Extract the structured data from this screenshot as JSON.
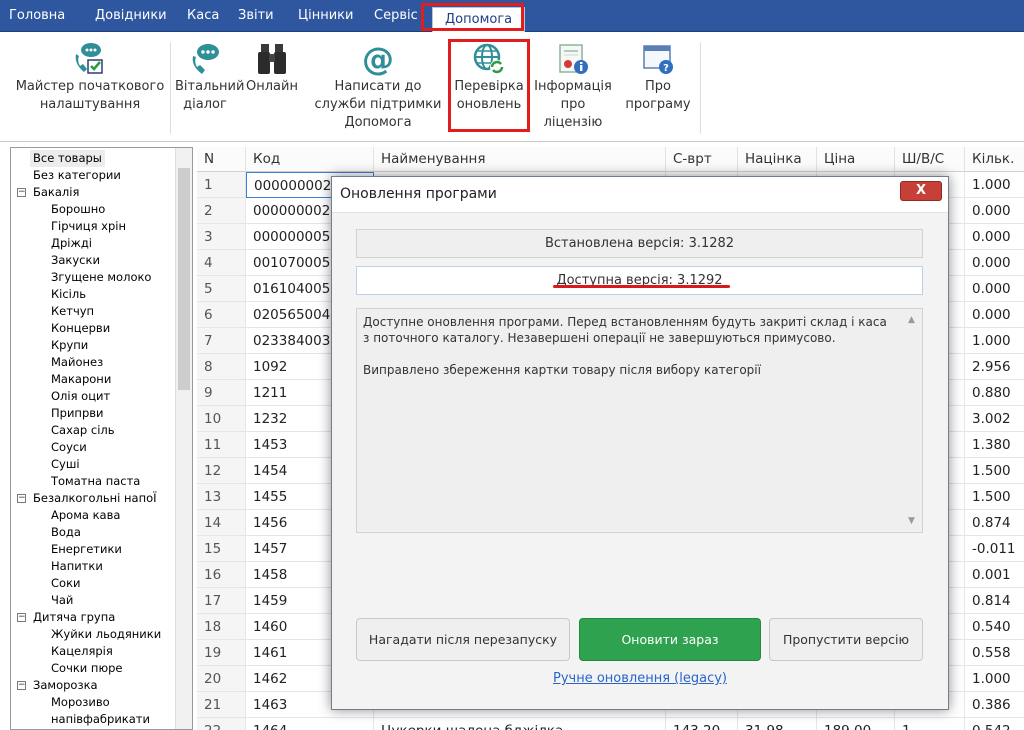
{
  "menu": {
    "items": [
      "Головна",
      "Довідники",
      "Каса",
      "Звіти",
      "Цінники",
      "Сервіс"
    ],
    "active": "Допомога"
  },
  "ribbon": {
    "buttons": [
      {
        "label": "Майстер початкового\nналаштування",
        "icon": "phone-chat-check-icon"
      },
      {
        "label": "Вітальний\nдіалог",
        "icon": "phone-chat-icon"
      },
      {
        "label": "Онлайн",
        "icon": "binoculars-icon"
      },
      {
        "label": "Написати до\nслужби підтримки\nДопомога",
        "icon": "at-sign-icon"
      },
      {
        "label": "Перевірка\nоновлень",
        "icon": "globe-refresh-icon"
      },
      {
        "label": "Інформація\nпро ліцензію",
        "icon": "certificate-info-icon"
      },
      {
        "label": "Про\nпрограму",
        "icon": "window-help-icon"
      }
    ]
  },
  "tree": {
    "items": [
      {
        "label": "Все товары",
        "level": 0,
        "selected": true
      },
      {
        "label": "Без категории",
        "level": 0
      },
      {
        "label": "Бакалія",
        "level": 0,
        "expandable": true
      },
      {
        "label": "Борошно",
        "level": 1
      },
      {
        "label": "Гірчиця хрін",
        "level": 1
      },
      {
        "label": "Дріжді",
        "level": 1
      },
      {
        "label": "Закуски",
        "level": 1
      },
      {
        "label": "Згущене молоко",
        "level": 1
      },
      {
        "label": "Кісіль",
        "level": 1
      },
      {
        "label": "Кетчуп",
        "level": 1
      },
      {
        "label": "Концерви",
        "level": 1
      },
      {
        "label": "Крупи",
        "level": 1
      },
      {
        "label": "Майонез",
        "level": 1
      },
      {
        "label": "Макарони",
        "level": 1
      },
      {
        "label": "Олія оцит",
        "level": 1
      },
      {
        "label": "Припрви",
        "level": 1
      },
      {
        "label": "Сахар сіль",
        "level": 1
      },
      {
        "label": "Соуси",
        "level": 1
      },
      {
        "label": "Суші",
        "level": 1
      },
      {
        "label": "Томатна паста",
        "level": 1
      },
      {
        "label": "Безалкогольні напоЇ",
        "level": 0,
        "expandable": true
      },
      {
        "label": "Арома кава",
        "level": 1
      },
      {
        "label": "Вода",
        "level": 1
      },
      {
        "label": "Енергетики",
        "level": 1
      },
      {
        "label": "Напитки",
        "level": 1
      },
      {
        "label": "Соки",
        "level": 1
      },
      {
        "label": "Чай",
        "level": 1
      },
      {
        "label": "Дитяча група",
        "level": 0,
        "expandable": true
      },
      {
        "label": "Жуйки льодяники",
        "level": 1
      },
      {
        "label": "Кацелярія",
        "level": 1
      },
      {
        "label": "Сочки пюре",
        "level": 1
      },
      {
        "label": "Заморозка",
        "level": 0,
        "expandable": true
      },
      {
        "label": "Морозиво",
        "level": 1
      },
      {
        "label": "напівфабрикати",
        "level": 1
      }
    ]
  },
  "grid": {
    "columns": [
      "N",
      "Код",
      "Найменування",
      "С-врт",
      "Націнка",
      "Ціна",
      "Ш/В/С",
      "Кільк."
    ],
    "rows": [
      [
        "1",
        "0000000023",
        "",
        "",
        "",
        "",
        "",
        "1.000"
      ],
      [
        "2",
        "0000000023",
        "",
        "",
        "",
        "",
        "",
        "0.000"
      ],
      [
        "3",
        "0000000053",
        "",
        "",
        "",
        "",
        "",
        "0.000"
      ],
      [
        "4",
        "0010700050",
        "",
        "",
        "",
        "",
        "",
        "0.000"
      ],
      [
        "5",
        "0161040053",
        "",
        "",
        "",
        "",
        "",
        "0.000"
      ],
      [
        "6",
        "0205650046",
        "",
        "",
        "",
        "",
        "",
        "0.000"
      ],
      [
        "7",
        "0233840038",
        "",
        "",
        "",
        "",
        "",
        "1.000"
      ],
      [
        "8",
        "1092",
        "",
        "",
        "",
        "",
        "",
        "2.956"
      ],
      [
        "9",
        "1211",
        "",
        "",
        "",
        "",
        "",
        "0.880"
      ],
      [
        "10",
        "1232",
        "",
        "",
        "",
        "",
        "",
        "3.002"
      ],
      [
        "11",
        "1453",
        "",
        "",
        "",
        "",
        "",
        "1.380"
      ],
      [
        "12",
        "1454",
        "",
        "",
        "",
        "",
        "",
        "1.500"
      ],
      [
        "13",
        "1455",
        "",
        "",
        "",
        "",
        "",
        "1.500"
      ],
      [
        "14",
        "1456",
        "",
        "",
        "",
        "",
        "",
        "0.874"
      ],
      [
        "15",
        "1457",
        "",
        "",
        "",
        "",
        "",
        "-0.011"
      ],
      [
        "16",
        "1458",
        "",
        "",
        "",
        "",
        "",
        "0.001"
      ],
      [
        "17",
        "1459",
        "",
        "",
        "",
        "",
        "",
        "0.814"
      ],
      [
        "18",
        "1460",
        "",
        "",
        "",
        "",
        "",
        "0.540"
      ],
      [
        "19",
        "1461",
        "",
        "",
        "",
        "",
        "",
        "0.558"
      ],
      [
        "20",
        "1462",
        "",
        "",
        "",
        "",
        "",
        "1.000"
      ],
      [
        "21",
        "1463",
        "",
        "",
        "",
        "",
        "",
        "0.386"
      ],
      [
        "22",
        "1464",
        "Цукерки шалена бджілка",
        "143.20",
        "31.98",
        "189.00",
        "1",
        "0.542"
      ]
    ]
  },
  "dialog": {
    "title": "Оновлення програми",
    "close_label": "X",
    "installed_version": "Встановлена версія: 3.1282",
    "available_version": "Доступна версія: 3.1292",
    "notes_p1": "Доступне оновлення програми. Перед встановленням будуть закриті склад і каса з поточного каталогу. Незавершені операції не завершуються примусово.",
    "notes_p2": "Виправлено збереження картки товару після вибору категорії",
    "buttons": {
      "remind": "Нагадати після перезапуску",
      "update": "Оновити зараз",
      "skip": "Пропустити версію"
    },
    "legacy_link": "Ручне оновлення (legacy)"
  },
  "colors": {
    "menubar": "#2e579f",
    "primary_button": "#2fa24f",
    "highlight": "#e11d1d",
    "link": "#2a64c8",
    "close_button": "#c64037"
  }
}
